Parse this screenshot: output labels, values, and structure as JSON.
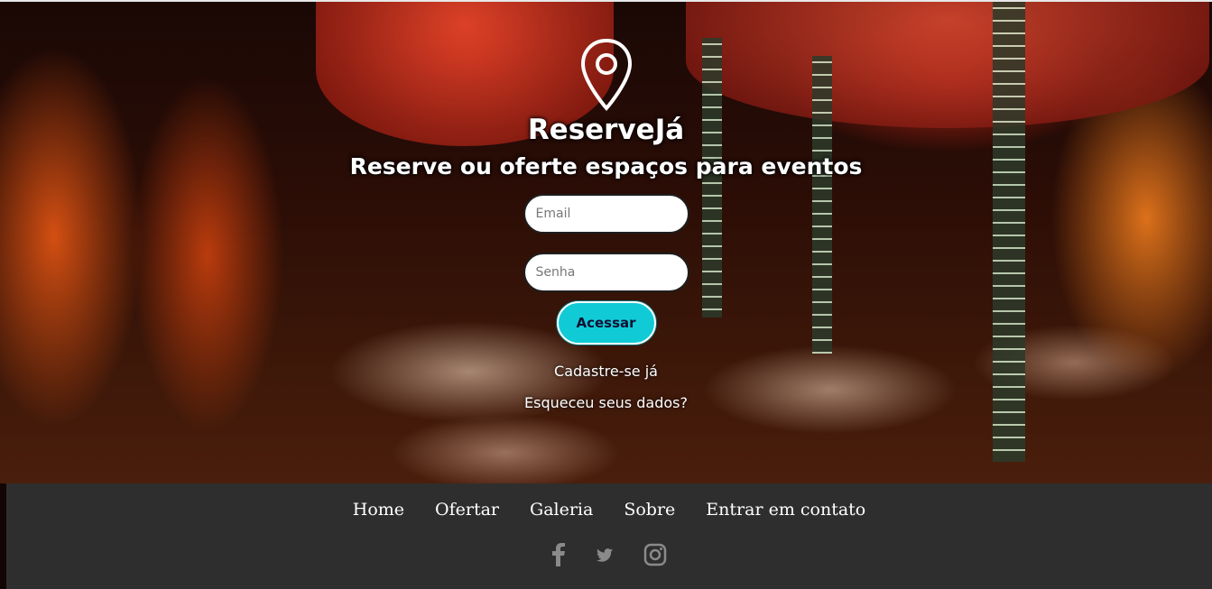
{
  "brand": {
    "name": "ReserveJá",
    "tagline": "Reserve ou oferte espaços para eventos"
  },
  "login": {
    "email_placeholder": "Email",
    "password_placeholder": "Senha",
    "submit_label": "Acessar",
    "signup_link": "Cadastre-se já",
    "forgot_link": "Esqueceu seus dados?"
  },
  "footer": {
    "nav": [
      "Home",
      "Ofertar",
      "Galeria",
      "Sobre",
      "Entrar em contato"
    ],
    "social": [
      "facebook-icon",
      "twitter-icon",
      "instagram-icon"
    ]
  },
  "colors": {
    "accent": "#10cbd6",
    "footer_bg": "#2e2e2e"
  }
}
